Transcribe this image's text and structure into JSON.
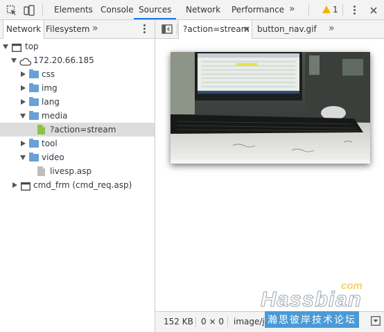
{
  "toolbar": {
    "icons": [
      "inspect-icon",
      "device-toggle-icon",
      "more-tabs-icon",
      "warning-icon",
      "settings-kebab-icon"
    ],
    "tabs": [
      {
        "label": "Elements",
        "active": false
      },
      {
        "label": "Console",
        "active": false
      },
      {
        "label": "Sources",
        "active": true
      },
      {
        "label": "Network",
        "active": false
      },
      {
        "label": "Performance",
        "active": false
      }
    ],
    "more_label": "»",
    "warning_count": "1"
  },
  "navigator": {
    "tabs": [
      {
        "label": "Network",
        "active": true
      },
      {
        "label": "Filesystem",
        "active": false
      }
    ],
    "more_label": "»",
    "tree": [
      {
        "label": "top"
      },
      {
        "label": "172.20.66.185"
      },
      {
        "label": "css"
      },
      {
        "label": "img"
      },
      {
        "label": "lang"
      },
      {
        "label": "media"
      },
      {
        "label": "?action=stream"
      },
      {
        "label": "tool"
      },
      {
        "label": "video"
      },
      {
        "label": "livesp.asp"
      },
      {
        "label": "cmd_frm (cmd_req.asp)"
      }
    ]
  },
  "editor": {
    "tabs": [
      {
        "label": "?action=stream",
        "active": true,
        "close": "×"
      },
      {
        "label": "button_nav.gif",
        "active": false
      }
    ],
    "more_label": "»"
  },
  "status": {
    "size": "152 KB",
    "dimensions": "0 × 0",
    "mime": "image/j"
  },
  "watermark": {
    "brand": "Hassbian",
    "domain": "com",
    "subtitle": "瀚思彼岸技术论坛"
  },
  "colors": {
    "accent": "#1a73e8",
    "folder": "#6aa0d8",
    "image_file": "#8bc34a",
    "selected_row": "#dddddd"
  }
}
